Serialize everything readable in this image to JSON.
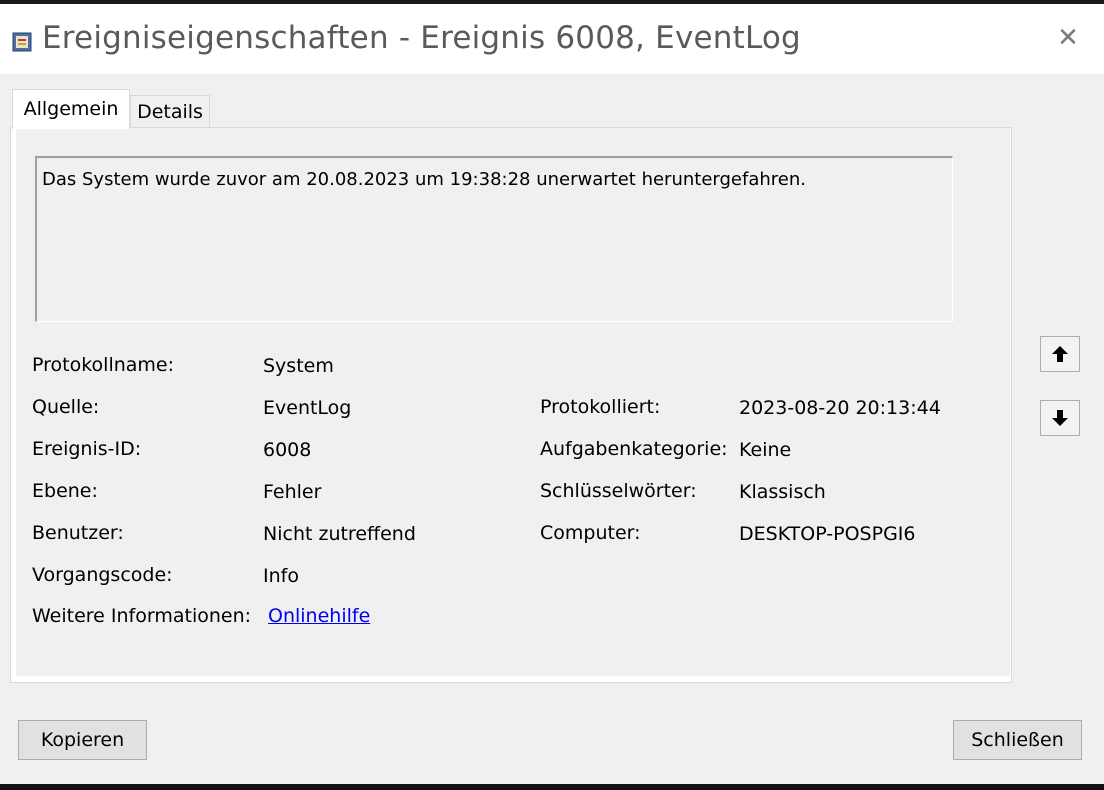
{
  "window": {
    "title": "Ereigniseigenschaften - Ereignis 6008, EventLog",
    "close_symbol": "✕",
    "icon": "event-log-icon"
  },
  "tabs": [
    {
      "label": "Allgemein",
      "active": true
    },
    {
      "label": "Details",
      "active": false
    }
  ],
  "description": "Das System wurde zuvor am 20.08.2023 um 19:38:28 unerwartet heruntergefahren.",
  "fields_left": [
    {
      "label": "Protokollname:",
      "value": "System"
    },
    {
      "label": "Quelle:",
      "value": "EventLog"
    },
    {
      "label": "Ereignis-ID:",
      "value": "6008"
    },
    {
      "label": "Ebene:",
      "value": "Fehler"
    },
    {
      "label": "Benutzer:",
      "value": "Nicht zutreffend"
    },
    {
      "label": "Vorgangscode:",
      "value": "Info"
    }
  ],
  "fields_right": [
    {
      "label": "Protokolliert:",
      "value": "2023-08-20 20:13:44"
    },
    {
      "label": "Aufgabenkategorie:",
      "value": "Keine"
    },
    {
      "label": "Schlüsselwörter:",
      "value": "Klassisch"
    },
    {
      "label": "Computer:",
      "value": "DESKTOP-POSPGI6"
    }
  ],
  "more_info": {
    "label": "Weitere Informationen:",
    "link": "Onlinehilfe"
  },
  "nav": {
    "up_icon": "arrow-up-icon",
    "down_icon": "arrow-down-icon"
  },
  "buttons": {
    "copy": "Kopieren",
    "close": "Schließen"
  },
  "colors": {
    "link": "#0000ee",
    "title_text": "#5a5a5a"
  }
}
